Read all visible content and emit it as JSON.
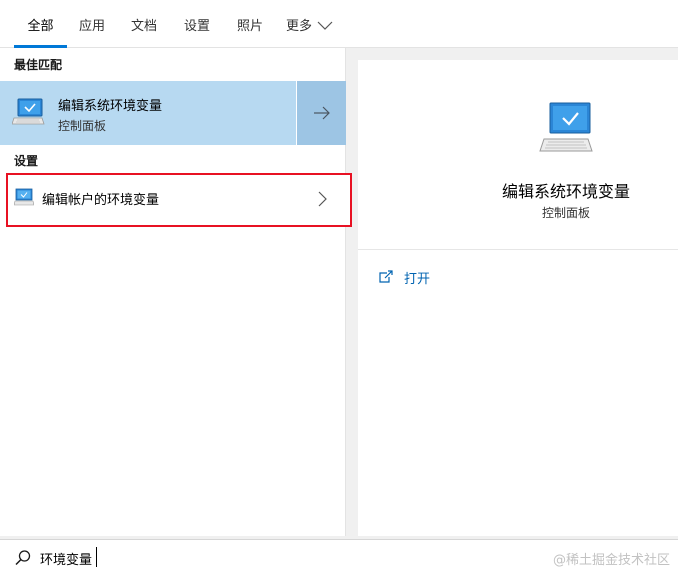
{
  "tabs": {
    "all": "全部",
    "apps": "应用",
    "docs": "文档",
    "settings": "设置",
    "photos": "照片",
    "more": "更多"
  },
  "sections": {
    "best_match": "最佳匹配",
    "settings": "设置"
  },
  "best_match": {
    "title": "编辑系统环境变量",
    "subtitle": "控制面板",
    "icon": "monitor-check-icon"
  },
  "settings_results": [
    {
      "label": "编辑帐户的环境变量",
      "icon": "monitor-icon"
    }
  ],
  "preview": {
    "title": "编辑系统环境变量",
    "subtitle": "控制面板",
    "action_open": "打开",
    "icon": "monitor-check-icon"
  },
  "search": {
    "value": "环境变量",
    "icon": "search-icon"
  },
  "watermark": "@稀土掘金技术社区",
  "colors": {
    "accent": "#0078d7",
    "selected_row": "#b7d9f1",
    "selected_arrow_cell": "#9dc5e4",
    "highlight_border": "#e81123",
    "link": "#0063b1"
  }
}
